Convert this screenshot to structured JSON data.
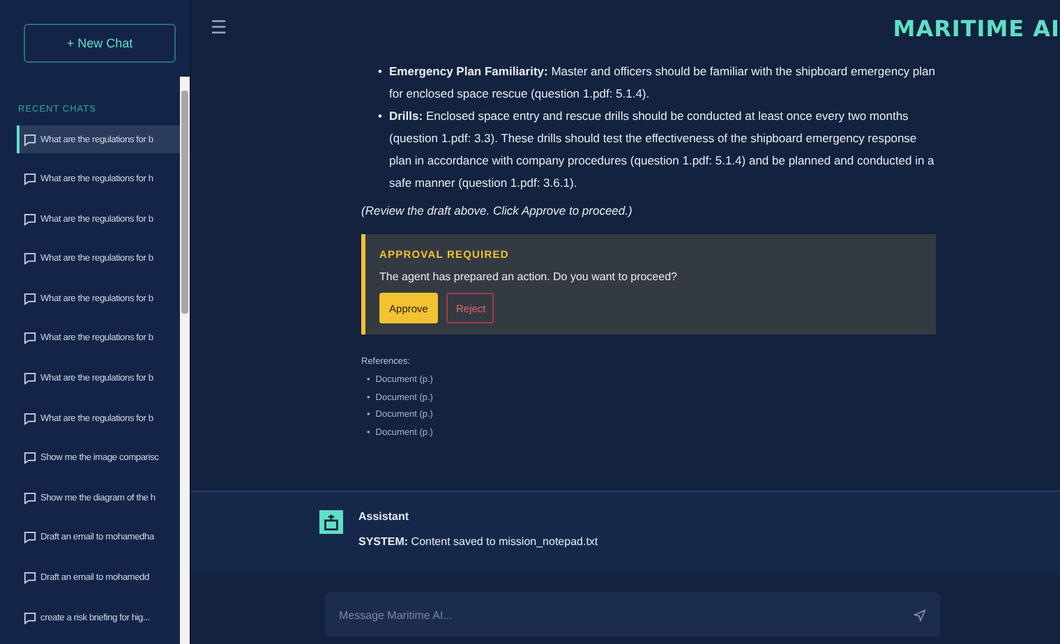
{
  "sidebar": {
    "new_chat_button": "+ New Chat",
    "section_label": "RECENT CHATS",
    "items": [
      {
        "label": "What are the regulations for b",
        "selected": true
      },
      {
        "label": "What are the regulations for h",
        "selected": false
      },
      {
        "label": "What are the regulations for b",
        "selected": false
      },
      {
        "label": "What are the regulations for b",
        "selected": false
      },
      {
        "label": "What are the regulations for b",
        "selected": false
      },
      {
        "label": "What are the regulations for b",
        "selected": false
      },
      {
        "label": "What are the regulations for b",
        "selected": false
      },
      {
        "label": "What are the regulations for b",
        "selected": false
      },
      {
        "label": "Show me the image comparisc",
        "selected": false
      },
      {
        "label": "Show me the diagram of the h",
        "selected": false
      },
      {
        "label": "Draft an email to mohamedha",
        "selected": false
      },
      {
        "label": "Draft an email to mohamedd",
        "selected": false
      },
      {
        "label": "create a risk briefing for hig...",
        "selected": false
      }
    ]
  },
  "header": {
    "menu_icon": "☰",
    "brand": "MARITIME AI"
  },
  "message": {
    "bullets": [
      {
        "marker": "•",
        "text": "**Emergency Plan Familiarity:** Master and officers should be familiar with the shipboard emergency plan for enclosed space rescue (question 1.pdf: 5.1.4)."
      },
      {
        "marker": "•",
        "text": "**Drills:** Enclosed space entry and rescue drills should be conducted at least once every two months (question 1.pdf: 3.3). These drills should test the effectiveness of the shipboard emergency response plan in accordance with company procedures (question 1.pdf: 5.1.4) and be planned and conducted in a safe manner (question 1.pdf: 3.6.1)."
      }
    ],
    "note": "(Review the draft above. Click Approve to proceed.)",
    "approval": {
      "title": "APPROVAL REQUIRED",
      "text": "The agent has prepared an action. Do you want to proceed?",
      "approve": "Approve",
      "reject": "Reject"
    },
    "references_label": "References:",
    "references": [
      {
        "marker": "•",
        "text": "Document (p.)"
      },
      {
        "marker": "•",
        "text": "Document (p.)"
      },
      {
        "marker": "•",
        "text": "Document (p.)"
      },
      {
        "marker": "•",
        "text": "Document (p.)"
      }
    ]
  },
  "assistant": {
    "name": "Assistant",
    "text": "**SYSTEM:** Content saved to mission_notepad.txt"
  },
  "composer": {
    "placeholder": "Message Maritime AI..."
  }
}
